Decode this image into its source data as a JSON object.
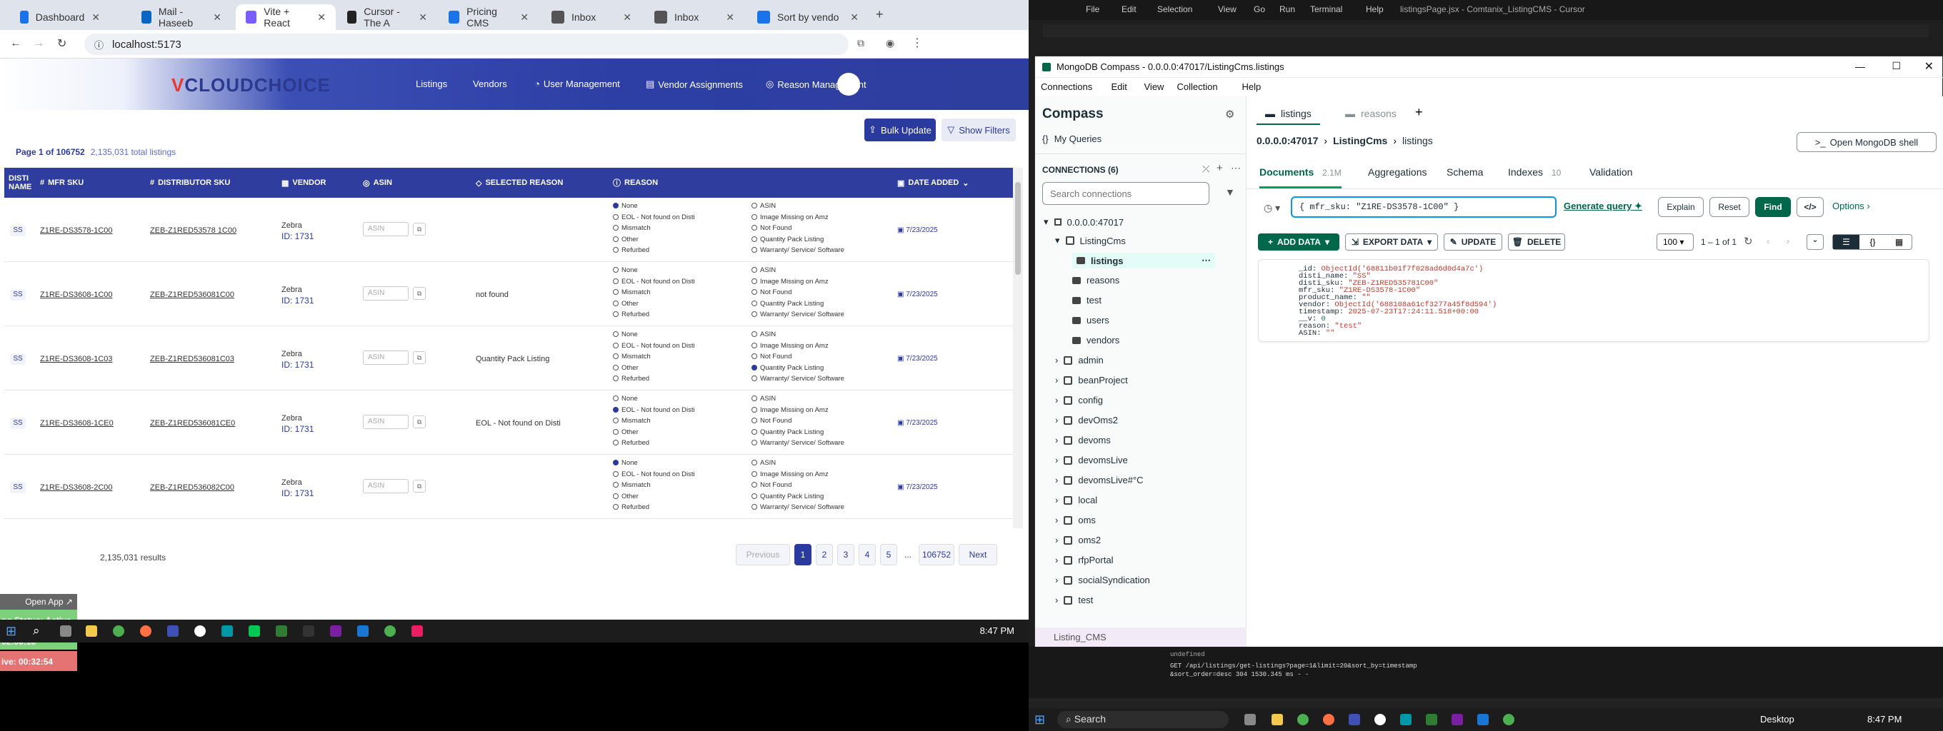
{
  "browser": {
    "tabs": [
      {
        "label": "Dashboard",
        "color": "#1a73e8"
      },
      {
        "label": "Mail - Haseeb",
        "color": "#0a66c2"
      },
      {
        "label": "Vite + React",
        "color": "#7b5cff"
      },
      {
        "label": "Cursor - The A",
        "color": "#222222"
      },
      {
        "label": "Pricing CMS",
        "color": "#1a73e8"
      },
      {
        "label": "Inbox",
        "color": "#555555"
      },
      {
        "label": "Inbox",
        "color": "#555555"
      },
      {
        "label": "Sort by vendo",
        "color": "#1a73e8"
      }
    ],
    "url": "localhost:5173"
  },
  "app": {
    "logo_v": "V",
    "logo_text": "CLOUDCHOICE",
    "nav": [
      "Listings",
      "Vendors",
      "User Management",
      "Vendor Assignments",
      "Reason Management"
    ],
    "bulk_update": "Bulk Update",
    "show_filters": "Show Filters",
    "page_of": "Page 1 of 106752",
    "total_listings": "2,135,031 total listings",
    "columns": [
      "DISTI NAME",
      "MFR SKU",
      "DISTRIBUTOR SKU",
      "VENDOR",
      "ASIN",
      "SELECTED REASON",
      "REASON",
      "DATE ADDED"
    ],
    "reason_options_left": [
      "None",
      "EOL - Not found on Disti",
      "Mismatch",
      "Other",
      "Refurbed"
    ],
    "reason_options_right": [
      "ASIN",
      "Image Missing on Amz",
      "Not Found",
      "Quantity Pack Listing",
      "Warranty/ Service/ Software"
    ],
    "asin_placeholder": "ASIN",
    "rows": [
      {
        "disti": "SS",
        "mfr": "Z1RE-DS3578-1C00",
        "dsku": "ZEB-Z1RED53578 1C00",
        "vendor": "Zebra",
        "vid": "ID: 1731",
        "selected": "",
        "sel_left": 0,
        "sel_right": -1,
        "date": "7/23/2025"
      },
      {
        "disti": "SS",
        "mfr": "Z1RE-DS3608-1C00",
        "dsku": "ZEB-Z1RED536081C00",
        "vendor": "Zebra",
        "vid": "ID: 1731",
        "selected": "not found",
        "sel_left": -1,
        "sel_right": -1,
        "date": "7/23/2025"
      },
      {
        "disti": "SS",
        "mfr": "Z1RE-DS3608-1C03",
        "dsku": "ZEB-Z1RED536081C03",
        "vendor": "Zebra",
        "vid": "ID: 1731",
        "selected": "Quantity Pack Listing",
        "sel_left": -1,
        "sel_right": 3,
        "date": "7/23/2025"
      },
      {
        "disti": "SS",
        "mfr": "Z1RE-DS3608-1CE0",
        "dsku": "ZEB-Z1RED536081CE0",
        "vendor": "Zebra",
        "vid": "ID: 1731",
        "selected": "EOL - Not found on Disti",
        "sel_left": 1,
        "sel_right": -1,
        "date": "7/23/2025"
      },
      {
        "disti": "SS",
        "mfr": "Z1RE-DS3608-2C00",
        "dsku": "ZEB-Z1RED536082C00",
        "vendor": "Zebra",
        "vid": "ID: 1731",
        "selected": "",
        "sel_left": 0,
        "sel_right": -1,
        "date": "7/23/2025"
      }
    ],
    "results": "2,135,031 results",
    "pagination": [
      "Previous",
      "1",
      "2",
      "3",
      "4",
      "5",
      "...",
      "106752",
      "Next"
    ],
    "tracker": {
      "open": "Open App ↗",
      "status": "ng Status: Active",
      "time1": "02:06:16",
      "time2": "ive: 00:32:54"
    }
  },
  "taskbar_left": {
    "time": "8:47 PM"
  },
  "cursor": {
    "menu": [
      "File",
      "Edit",
      "Selection",
      "View",
      "Go",
      "Run",
      "Terminal",
      "Help"
    ],
    "title": "listingsPage.jsx - Comtanix_ListingCMS - Cursor",
    "terminal_line1": "GET /api/listings/get-listings?page=1&limit=20&sort_by=timestamp",
    "terminal_line2": "&sort_order=desc 304 1530.345 ms - -",
    "terminal_line3": "undefined"
  },
  "compass": {
    "window_title": "MongoDB Compass - 0.0.0.0:47017/ListingCms.listings",
    "menu": [
      "Connections",
      "Edit",
      "View",
      "Collection",
      "Help"
    ],
    "brand": "Compass",
    "my_queries": "My Queries",
    "connections_label": "CONNECTIONS (6)",
    "search_placeholder": "Search connections",
    "host": "0.0.0.0:47017",
    "tree": [
      {
        "name": "ListingCms",
        "level": 1,
        "db": true
      },
      {
        "name": "listings",
        "level": 2,
        "db": false,
        "active": true
      },
      {
        "name": "reasons",
        "level": 2,
        "db": false
      },
      {
        "name": "test",
        "level": 2,
        "db": false
      },
      {
        "name": "users",
        "level": 2,
        "db": false
      },
      {
        "name": "vendors",
        "level": 2,
        "db": false
      },
      {
        "name": "admin",
        "level": 1,
        "db": true
      },
      {
        "name": "beanProject",
        "level": 1,
        "db": true
      },
      {
        "name": "config",
        "level": 1,
        "db": true
      },
      {
        "name": "devOms2",
        "level": 1,
        "db": true
      },
      {
        "name": "devoms",
        "level": 1,
        "db": true
      },
      {
        "name": "devomsLive",
        "level": 1,
        "db": true
      },
      {
        "name": "devomsLive#°C",
        "level": 1,
        "db": true
      },
      {
        "name": "local",
        "level": 1,
        "db": true
      },
      {
        "name": "oms",
        "level": 1,
        "db": true
      },
      {
        "name": "oms2",
        "level": 1,
        "db": true
      },
      {
        "name": "rfpPortal",
        "level": 1,
        "db": true
      },
      {
        "name": "socialSyndication",
        "level": 1,
        "db": true
      },
      {
        "name": "test",
        "level": 1,
        "db": true
      }
    ],
    "bottom_item": "Listing_CMS",
    "tabs": [
      "listings",
      "reasons"
    ],
    "breadcrumb": [
      "0.0.0.0:47017",
      "ListingCms",
      "listings"
    ],
    "open_shell": "Open MongoDB shell",
    "subtabs": [
      "Documents",
      "2.1M",
      "Aggregations",
      "Schema",
      "Indexes",
      "10",
      "Validation"
    ],
    "query": "{ mfr_sku: \"Z1RE-DS3578-1C00\" }",
    "generate_query": "Generate query",
    "explain": "Explain",
    "reset": "Reset",
    "find": "Find",
    "options": "Options",
    "add_data": "ADD DATA",
    "export_data": "EXPORT DATA",
    "update": "UPDATE",
    "delete": "DELETE",
    "page_size": "100",
    "range": "1 – 1 of 1",
    "document": [
      {
        "k": "_id",
        "v": "ObjectId('68811b01f7f028ad6d0d4a7c')",
        "t": "v"
      },
      {
        "k": "disti_name",
        "v": "\"SS\"",
        "t": "v"
      },
      {
        "k": "disti_sku",
        "v": "\"ZEB-Z1RED535781C00\"",
        "t": "v"
      },
      {
        "k": "mfr_sku",
        "v": "\"Z1RE-DS3578-1C00\"",
        "t": "v"
      },
      {
        "k": "product_name",
        "v": "\"\"",
        "t": "v"
      },
      {
        "k": "vendor",
        "v": "ObjectId('688108a61cf3277a45f8d594')",
        "t": "v"
      },
      {
        "k": "timestamp",
        "v": "2025-07-23T17:24:11.518+00:00",
        "t": "v"
      },
      {
        "k": "__v",
        "v": "0",
        "t": "n"
      },
      {
        "k": "reason",
        "v": "\"test\"",
        "t": "v"
      },
      {
        "k": "ASIN",
        "v": "\"\"",
        "t": "v"
      }
    ]
  },
  "taskbar_right": {
    "search": "Search",
    "desktop": "Desktop",
    "time": "8:47 PM"
  }
}
